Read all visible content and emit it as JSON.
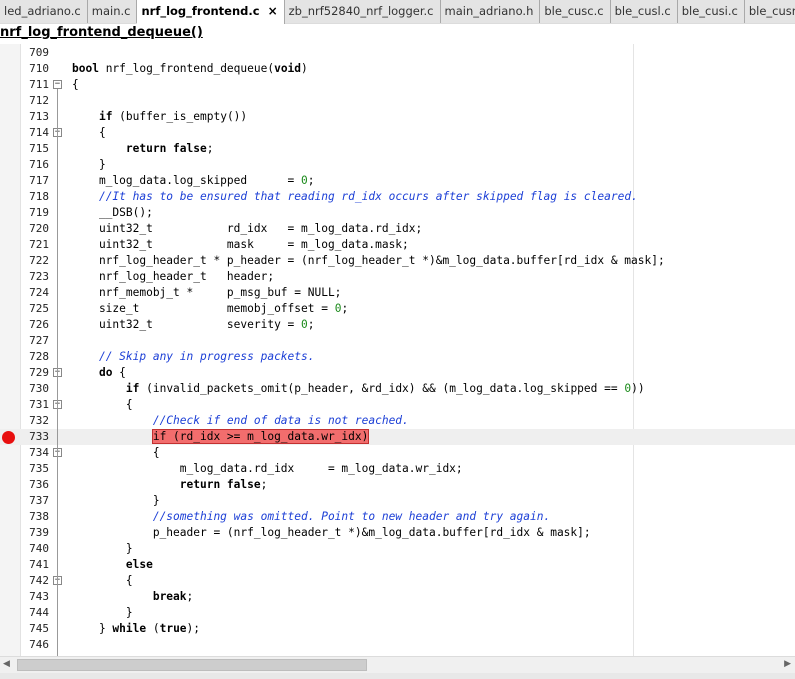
{
  "tabs": [
    {
      "label": "led_adriano.c",
      "active": false
    },
    {
      "label": "main.c",
      "active": false
    },
    {
      "label": "nrf_log_frontend.c",
      "active": true
    },
    {
      "label": "zb_nrf52840_nrf_logger.c",
      "active": false
    },
    {
      "label": "main_adriano.h",
      "active": false
    },
    {
      "label": "ble_cusc.c",
      "active": false
    },
    {
      "label": "ble_cusl.c",
      "active": false
    },
    {
      "label": "ble_cusi.c",
      "active": false
    },
    {
      "label": "ble_cusn.c",
      "active": false
    },
    {
      "label": "ble_cuss.c",
      "active": false
    }
  ],
  "tab_close_glyph": "×",
  "function_title": "nrf_log_frontend_dequeue()",
  "icons": {
    "fold_collapse": "minus-box-icon",
    "breakpoint": "red-dot-icon",
    "scroll_left": "arrow-left-icon",
    "scroll_right": "arrow-right-icon"
  },
  "colors": {
    "comment": "#1c3fd6",
    "number": "#1a8a1a",
    "highlight": "#f26d6d",
    "breakpoint": "#e80f0f"
  },
  "scroll_glyphs": {
    "left": "◀",
    "right": "▶"
  },
  "lines": [
    {
      "n": "709",
      "fold": false,
      "segs": []
    },
    {
      "n": "710",
      "fold": false,
      "segs": [
        {
          "t": "bool",
          "c": "kw"
        },
        {
          "t": " nrf_log_frontend_dequeue("
        },
        {
          "t": "void",
          "c": "kw"
        },
        {
          "t": ")"
        }
      ]
    },
    {
      "n": "711",
      "fold": true,
      "segs": [
        {
          "t": "{"
        }
      ]
    },
    {
      "n": "712",
      "fold": false,
      "segs": []
    },
    {
      "n": "713",
      "fold": false,
      "segs": [
        {
          "t": "    "
        },
        {
          "t": "if",
          "c": "kw"
        },
        {
          "t": " (buffer_is_empty())"
        }
      ]
    },
    {
      "n": "714",
      "fold": true,
      "segs": [
        {
          "t": "    {"
        }
      ]
    },
    {
      "n": "715",
      "fold": false,
      "segs": [
        {
          "t": "        "
        },
        {
          "t": "return false",
          "c": "kw"
        },
        {
          "t": ";"
        }
      ]
    },
    {
      "n": "716",
      "fold": false,
      "segs": [
        {
          "t": "    }"
        }
      ]
    },
    {
      "n": "717",
      "fold": false,
      "segs": [
        {
          "t": "    m_log_data.log_skipped      = "
        },
        {
          "t": "0",
          "c": "nm"
        },
        {
          "t": ";"
        }
      ]
    },
    {
      "n": "718",
      "fold": false,
      "segs": [
        {
          "t": "    "
        },
        {
          "t": "//It has to be ensured that reading rd_idx occurs after skipped flag is cleared.",
          "c": "cm"
        }
      ]
    },
    {
      "n": "719",
      "fold": false,
      "segs": [
        {
          "t": "    __DSB();"
        }
      ]
    },
    {
      "n": "720",
      "fold": false,
      "segs": [
        {
          "t": "    uint32_t           rd_idx   = m_log_data.rd_idx;"
        }
      ]
    },
    {
      "n": "721",
      "fold": false,
      "segs": [
        {
          "t": "    uint32_t           mask     = m_log_data.mask;"
        }
      ]
    },
    {
      "n": "722",
      "fold": false,
      "segs": [
        {
          "t": "    nrf_log_header_t * p_header = (nrf_log_header_t *)&m_log_data.buffer[rd_idx & mask];"
        }
      ]
    },
    {
      "n": "723",
      "fold": false,
      "segs": [
        {
          "t": "    nrf_log_header_t   header;"
        }
      ]
    },
    {
      "n": "724",
      "fold": false,
      "segs": [
        {
          "t": "    nrf_memobj_t *     p_msg_buf = NULL;"
        }
      ]
    },
    {
      "n": "725",
      "fold": false,
      "segs": [
        {
          "t": "    size_t             memobj_offset = "
        },
        {
          "t": "0",
          "c": "nm"
        },
        {
          "t": ";"
        }
      ]
    },
    {
      "n": "726",
      "fold": false,
      "segs": [
        {
          "t": "    uint32_t           severity = "
        },
        {
          "t": "0",
          "c": "nm"
        },
        {
          "t": ";"
        }
      ]
    },
    {
      "n": "727",
      "fold": false,
      "segs": []
    },
    {
      "n": "728",
      "fold": false,
      "segs": [
        {
          "t": "    "
        },
        {
          "t": "// Skip any in progress packets.",
          "c": "cm"
        }
      ]
    },
    {
      "n": "729",
      "fold": true,
      "segs": [
        {
          "t": "    "
        },
        {
          "t": "do",
          "c": "kw"
        },
        {
          "t": " {"
        }
      ]
    },
    {
      "n": "730",
      "fold": false,
      "segs": [
        {
          "t": "        "
        },
        {
          "t": "if",
          "c": "kw"
        },
        {
          "t": " (invalid_packets_omit(p_header, &rd_idx) && (m_log_data.log_skipped == "
        },
        {
          "t": "0",
          "c": "nm"
        },
        {
          "t": "))"
        }
      ]
    },
    {
      "n": "731",
      "fold": true,
      "segs": [
        {
          "t": "        {"
        }
      ]
    },
    {
      "n": "732",
      "fold": false,
      "segs": [
        {
          "t": "            "
        },
        {
          "t": "//Check if end of data is not reached.",
          "c": "cm"
        }
      ]
    },
    {
      "n": "733",
      "fold": false,
      "bp": true,
      "current": true,
      "segs": [
        {
          "t": "            "
        },
        {
          "t": "if (rd_idx >= m_log_data.wr_idx)",
          "c": "hl"
        }
      ]
    },
    {
      "n": "734",
      "fold": true,
      "segs": [
        {
          "t": "            {"
        }
      ]
    },
    {
      "n": "735",
      "fold": false,
      "segs": [
        {
          "t": "                m_log_data.rd_idx     = m_log_data.wr_idx;"
        }
      ]
    },
    {
      "n": "736",
      "fold": false,
      "segs": [
        {
          "t": "                "
        },
        {
          "t": "return false",
          "c": "kw"
        },
        {
          "t": ";"
        }
      ]
    },
    {
      "n": "737",
      "fold": false,
      "segs": [
        {
          "t": "            }"
        }
      ]
    },
    {
      "n": "738",
      "fold": false,
      "segs": [
        {
          "t": "            "
        },
        {
          "t": "//something was omitted. Point to new header and try again.",
          "c": "cm"
        }
      ]
    },
    {
      "n": "739",
      "fold": false,
      "segs": [
        {
          "t": "            p_header = (nrf_log_header_t *)&m_log_data.buffer[rd_idx & mask];"
        }
      ]
    },
    {
      "n": "740",
      "fold": false,
      "segs": [
        {
          "t": "        }"
        }
      ]
    },
    {
      "n": "741",
      "fold": false,
      "segs": [
        {
          "t": "        "
        },
        {
          "t": "else",
          "c": "kw"
        }
      ]
    },
    {
      "n": "742",
      "fold": true,
      "segs": [
        {
          "t": "        {"
        }
      ]
    },
    {
      "n": "743",
      "fold": false,
      "segs": [
        {
          "t": "            "
        },
        {
          "t": "break",
          "c": "kw"
        },
        {
          "t": ";"
        }
      ]
    },
    {
      "n": "744",
      "fold": false,
      "segs": [
        {
          "t": "        }"
        }
      ]
    },
    {
      "n": "745",
      "fold": false,
      "segs": [
        {
          "t": "    } "
        },
        {
          "t": "while",
          "c": "kw"
        },
        {
          "t": " ("
        },
        {
          "t": "true",
          "c": "kw"
        },
        {
          "t": ");"
        }
      ]
    },
    {
      "n": "746",
      "fold": false,
      "segs": []
    }
  ]
}
